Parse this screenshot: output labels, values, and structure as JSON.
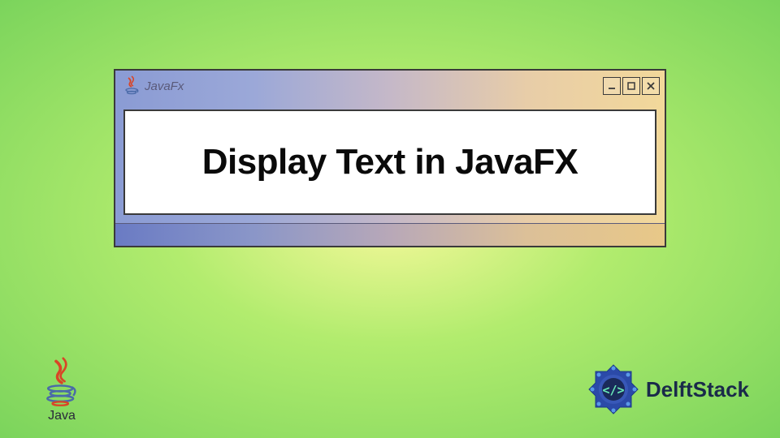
{
  "window": {
    "title_logo_text": "JavaFx",
    "main_text": "Display Text in JavaFX"
  },
  "footer": {
    "java_label": "Java",
    "brand_name": "DelftStack"
  },
  "icons": {
    "minimize": "minimize-icon",
    "maximize": "maximize-icon",
    "close": "close-icon"
  }
}
